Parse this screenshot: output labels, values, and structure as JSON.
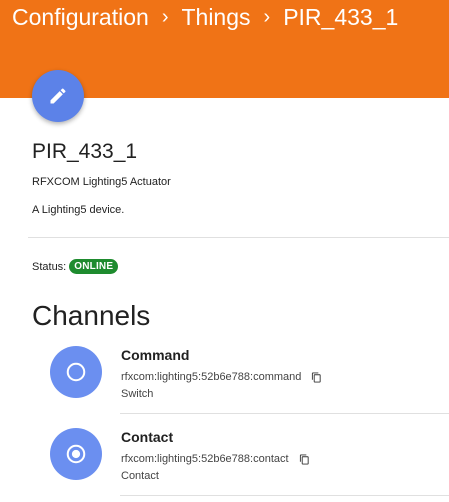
{
  "breadcrumb": {
    "items": [
      "Configuration",
      "Things",
      "PIR_433_1"
    ],
    "separator": "›"
  },
  "fab": {
    "icon": "pencil-icon"
  },
  "thing": {
    "name": "PIR_433_1",
    "type": "RFXCOM Lighting5 Actuator",
    "description": "A Lighting5 device."
  },
  "status": {
    "label": "Status:",
    "value": "ONLINE",
    "color": "#1e8b2e"
  },
  "channels": {
    "heading": "Channels",
    "items": [
      {
        "name": "Command",
        "uid": "rfxcom:lighting5:52b6e788:command",
        "type": "Switch",
        "icon": "radio-unchecked-icon"
      },
      {
        "name": "Contact",
        "uid": "rfxcom:lighting5:52b6e788:contact",
        "type": "Contact",
        "icon": "radio-checked-icon"
      }
    ]
  },
  "colors": {
    "header": "#f07316",
    "accent": "#5c82e8",
    "channel_icon": "#6b8ff0"
  }
}
